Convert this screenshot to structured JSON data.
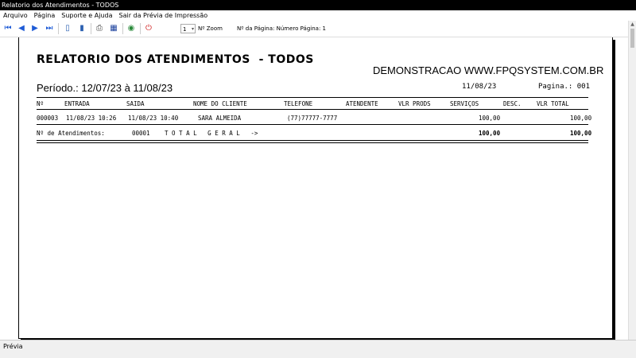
{
  "window": {
    "title": "Relatorio dos Atendimentos  - TODOS"
  },
  "menu": [
    "Arquivo",
    "Página",
    "Suporte e Ajuda",
    "Sair da Prévia de Impressão"
  ],
  "toolbar": {
    "zoom_value": "1",
    "zoom_label": "Nº Zoom",
    "page_label": "Nº da Página: Número Página: 1"
  },
  "report": {
    "title": "RELATORIO DOS ATENDIMENTOS  - TODOS",
    "company": "DEMONSTRACAO WWW.FPQSYSTEM.COM.BR",
    "period": "Período.: 12/07/23 à 11/08/23",
    "date": "11/08/23",
    "page": "Pagina.: 001",
    "columns": {
      "num": "Nº",
      "entrada": "ENTRADA",
      "saida": "SAIDA",
      "cliente": "NOME DO CLIENTE",
      "telefone": "TELEFONE",
      "atendente": "ATENDENTE",
      "vlr_prods": "VLR PRODS",
      "servicos": "SERVIÇOS",
      "desc": "DESC.",
      "vlr_total": "VLR TOTAL"
    },
    "rows": [
      {
        "num": "000003",
        "entrada": "11/08/23 10:26",
        "saida": "11/08/23 10:40",
        "cliente": "SARA ALMEIDA",
        "telefone": "(77)77777-7777",
        "atendente": "",
        "vlr_prods": "",
        "servicos": "100,00",
        "desc": "",
        "vlr_total": "100,00"
      }
    ],
    "footer": {
      "count_label": "Nº de Atendimentos:",
      "count": "00001",
      "total_label": "T O T A L   G E R A L   ->",
      "servicos": "100,00",
      "vlr_total": "100,00"
    }
  },
  "status": {
    "text": "Prévia"
  }
}
